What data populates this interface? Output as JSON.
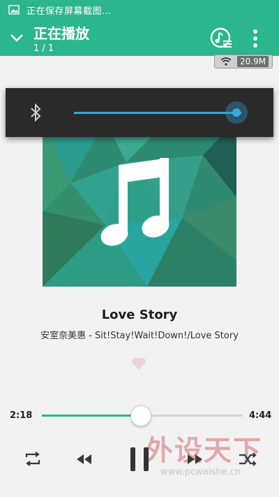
{
  "status_bar": {
    "text": "正在保存屏幕截图..."
  },
  "header": {
    "title": "正在播放",
    "subtitle": "1 / 1"
  },
  "network": {
    "speed": "20.9M"
  },
  "volume": {
    "level": 0.97
  },
  "song": {
    "title": "Love Story",
    "subtitle": "安室奈美惠 - Sit!Stay!Wait!Down!/Love Story"
  },
  "progress": {
    "current": "2:18",
    "total": "4:44",
    "fraction": 0.49
  },
  "colors": {
    "accent": "#2cb68e",
    "volume_accent": "#37a6da"
  },
  "watermark": {
    "logo": "外设天下",
    "url": "www.pcwaishe.cn"
  }
}
